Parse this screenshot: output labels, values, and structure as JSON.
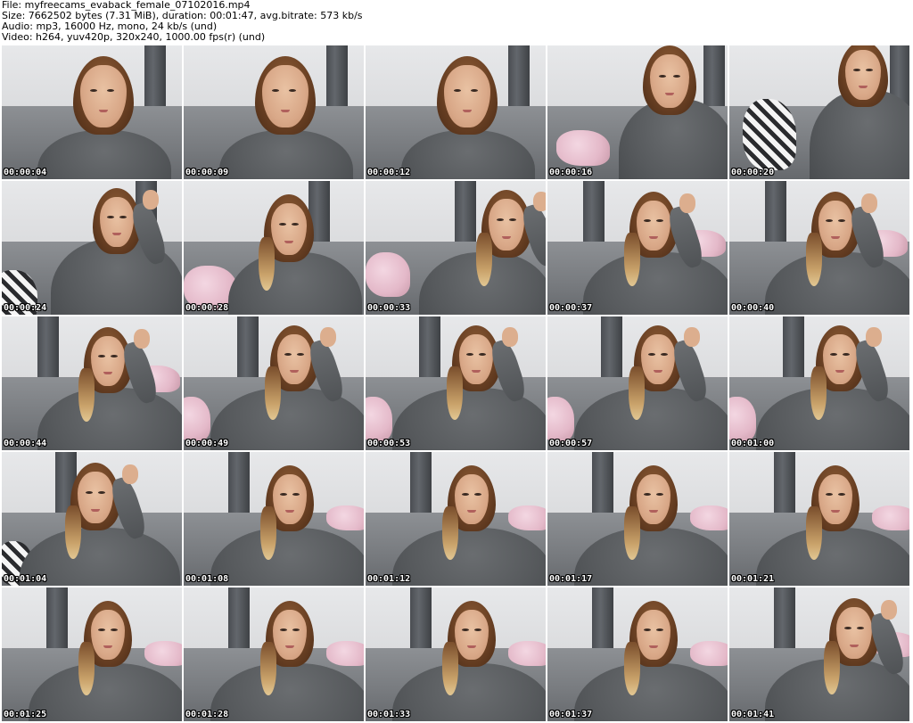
{
  "header": {
    "file_line": "File: myfreecams_evaback_female_07102016.mp4",
    "size_line": "Size: 7662502 bytes (7.31 MiB), duration: 00:01:47, avg.bitrate: 573 kb/s",
    "audio_line": "Audio: mp3, 16000 Hz, mono, 24 kb/s (und)",
    "video_line": "Video: h264, yuv420p, 320x240, 1000.00 fps(r) (und)"
  },
  "thumbnails": [
    {
      "timestamp": "00:00:04"
    },
    {
      "timestamp": "00:00:09"
    },
    {
      "timestamp": "00:00:12"
    },
    {
      "timestamp": "00:00:16"
    },
    {
      "timestamp": "00:00:20"
    },
    {
      "timestamp": "00:00:24"
    },
    {
      "timestamp": "00:00:28"
    },
    {
      "timestamp": "00:00:33"
    },
    {
      "timestamp": "00:00:37"
    },
    {
      "timestamp": "00:00:40"
    },
    {
      "timestamp": "00:00:44"
    },
    {
      "timestamp": "00:00:49"
    },
    {
      "timestamp": "00:00:53"
    },
    {
      "timestamp": "00:00:57"
    },
    {
      "timestamp": "00:01:00"
    },
    {
      "timestamp": "00:01:04"
    },
    {
      "timestamp": "00:01:08"
    },
    {
      "timestamp": "00:01:12"
    },
    {
      "timestamp": "00:01:17"
    },
    {
      "timestamp": "00:01:21"
    },
    {
      "timestamp": "00:01:25"
    },
    {
      "timestamp": "00:01:28"
    },
    {
      "timestamp": "00:01:33"
    },
    {
      "timestamp": "00:01:37"
    },
    {
      "timestamp": "00:01:41"
    }
  ],
  "colors": {
    "background": "#ffffff",
    "header_text": "#000000",
    "timestamp_text": "#ffffff",
    "timestamp_outline": "#000000"
  }
}
